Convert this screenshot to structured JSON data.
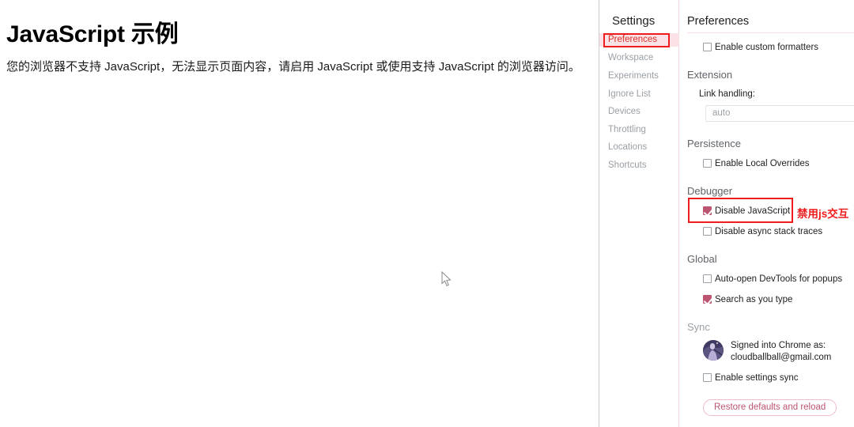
{
  "webpage": {
    "title": "JavaScript 示例",
    "paragraph": "您的浏览器不支持 JavaScript，无法显示页面内容，请启用 JavaScript 或使用支持 JavaScript 的浏览器访问。"
  },
  "devtools": {
    "sidebar": {
      "heading": "Settings",
      "items": [
        {
          "label": "Preferences",
          "selected": true
        },
        {
          "label": "Workspace",
          "selected": false
        },
        {
          "label": "Experiments",
          "selected": false
        },
        {
          "label": "Ignore List",
          "selected": false
        },
        {
          "label": "Devices",
          "selected": false
        },
        {
          "label": "Throttling",
          "selected": false
        },
        {
          "label": "Locations",
          "selected": false
        },
        {
          "label": "Shortcuts",
          "selected": false
        }
      ]
    },
    "preferences": {
      "title": "Preferences",
      "appearance": {
        "enable_custom_formatters": {
          "label": "Enable custom formatters",
          "checked": false
        }
      },
      "extension": {
        "section": "Extension",
        "link_handling_label": "Link handling:",
        "link_handling_value": "auto"
      },
      "persistence": {
        "section": "Persistence",
        "enable_local_overrides": {
          "label": "Enable Local Overrides",
          "checked": false
        }
      },
      "debugger": {
        "section": "Debugger",
        "disable_javascript": {
          "label": "Disable JavaScript",
          "checked": true
        },
        "disable_async_stack_traces": {
          "label": "Disable async stack traces",
          "checked": false
        }
      },
      "global": {
        "section": "Global",
        "auto_open_devtools": {
          "label": "Auto-open DevTools for popups",
          "checked": false
        },
        "search_as_you_type": {
          "label": "Search as you type",
          "checked": true
        }
      },
      "sync": {
        "section": "Sync",
        "signed_in_line1": "Signed into Chrome as:",
        "signed_in_line2": "cloudballball@gmail.com",
        "enable_settings_sync": {
          "label": "Enable settings sync",
          "checked": false
        },
        "restore_button": "Restore defaults and reload"
      }
    }
  },
  "annotations": {
    "preferences_box": "",
    "disable_js_text": "禁用js交互"
  },
  "colors": {
    "annotation_red": "#ee1c1c",
    "selected_bg": "#fbe2e7",
    "selected_text": "#d93025",
    "checkbox_checked": "#bd5570",
    "accent_pink": "#f0bcc8"
  }
}
